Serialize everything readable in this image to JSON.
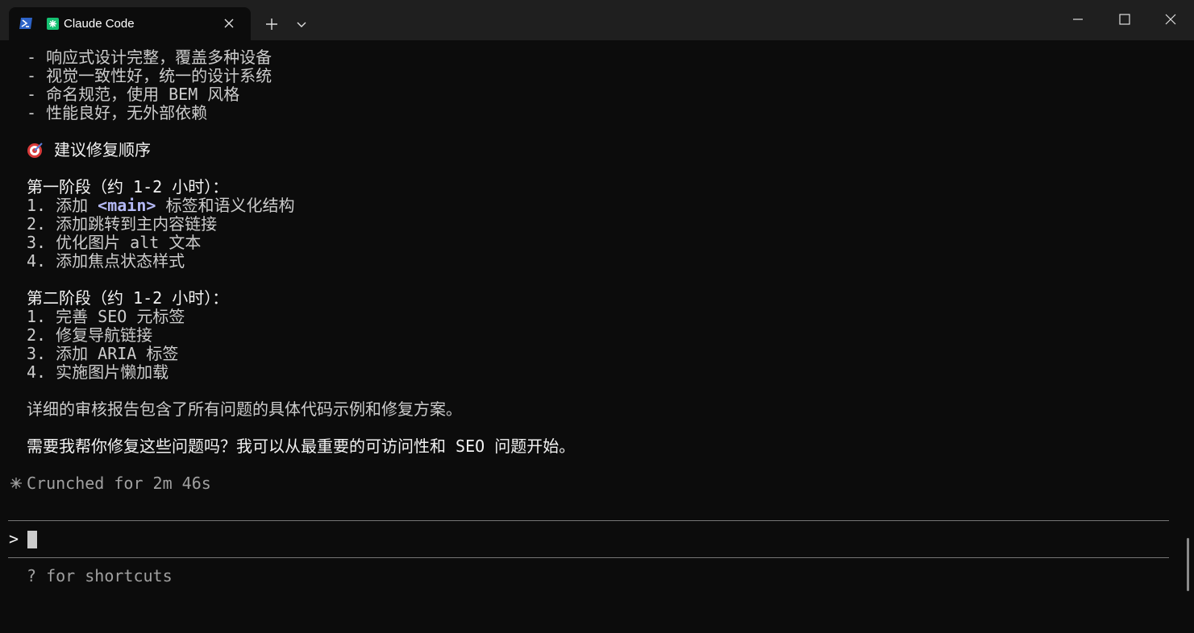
{
  "window": {
    "tab_title": "Claude Code"
  },
  "colors": {
    "background": "#0c0c0c",
    "titlebar": "#1f1f1f",
    "text": "#cccccc",
    "inline_code": "#b4b9f5",
    "dim_text": "#a0a0a0",
    "claude_icon_green": "#16c172",
    "powershell_blue": "#2d63c8"
  },
  "icons": {
    "shell": "powershell-icon",
    "tab_app": "claude-icon",
    "close_tab": "close-icon",
    "new_tab": "plus-icon",
    "tab_menu": "chevron-down-icon",
    "heading": "target-icon",
    "status": "spark-icon"
  },
  "output": {
    "bullets": [
      "- 响应式设计完整，覆盖多种设备",
      "- 视觉一致性好，统一的设计系统",
      "- 命名规范，使用 BEM 风格",
      "- 性能良好，无外部依赖"
    ],
    "heading": "建议修复顺序",
    "phase1": {
      "title": "第一阶段（约 1-2 小时）：",
      "item1_prefix": "1. 添加 ",
      "item1_code": "<main>",
      "item1_suffix": " 标签和语义化结构",
      "item2": "2. 添加跳转到主内容链接",
      "item3": "3. 优化图片 alt 文本",
      "item4": "4. 添加焦点状态样式"
    },
    "phase2": {
      "title": "第二阶段（约 1-2 小时）：",
      "items": [
        "1. 完善 SEO 元标签",
        "2. 修复导航链接",
        "3. 添加 ARIA 标签",
        "4. 实施图片懒加载"
      ]
    },
    "summary": "详细的审核报告包含了所有问题的具体代码示例和修复方案。",
    "question": "需要我帮你修复这些问题吗？我可以从最重要的可访问性和 SEO 问题开始。"
  },
  "status": {
    "text": "Crunched for 2m 46s"
  },
  "input": {
    "prompt_symbol": ">",
    "value": ""
  },
  "footer": {
    "hint": "? for shortcuts"
  }
}
